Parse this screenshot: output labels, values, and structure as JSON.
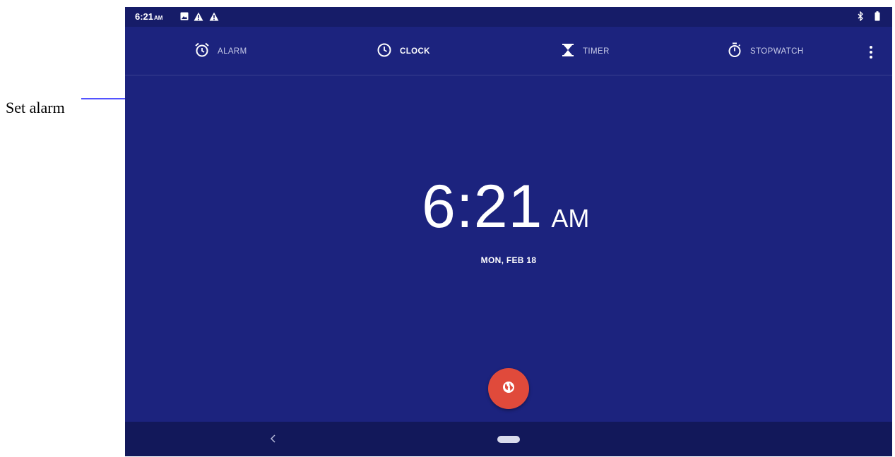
{
  "annotation": {
    "label": "Set alarm"
  },
  "status_bar": {
    "time": "6:21",
    "ampm": "AM",
    "icons": [
      "image-icon",
      "warning-icon",
      "warning-icon",
      "bluetooth-icon",
      "battery-icon"
    ]
  },
  "tabs": [
    {
      "label": "ALARM",
      "icon": "alarm-icon",
      "active": false
    },
    {
      "label": "CLOCK",
      "icon": "clock-icon",
      "active": true
    },
    {
      "label": "TIMER",
      "icon": "hourglass-icon",
      "active": false
    },
    {
      "label": "STOPWATCH",
      "icon": "stopwatch-icon",
      "active": false
    }
  ],
  "overflow_menu": {
    "icon": "more-vert-icon"
  },
  "clock": {
    "time": "6:21",
    "ampm": "AM",
    "date": "MON, FEB 18"
  },
  "fab": {
    "icon": "globe-icon"
  },
  "nav_bar": {
    "back_icon": "back-icon",
    "home_icon": "home-pill-icon"
  },
  "colors": {
    "background": "#1c237e",
    "status_bar": "#161c68",
    "nav_bar": "#12185a",
    "fab": "#e04a3b",
    "annotation_line": "#1a1aff"
  }
}
